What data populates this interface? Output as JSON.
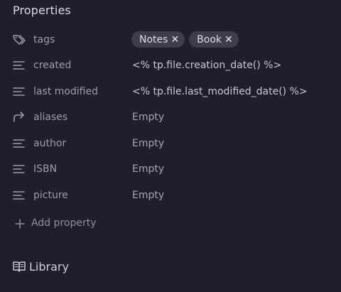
{
  "properties": {
    "heading": "Properties",
    "rows": [
      {
        "icon": "tags-icon",
        "key": "tags",
        "tags": [
          "Notes",
          "Book"
        ],
        "remove_glyph": "✕"
      },
      {
        "icon": "text-lines-icon",
        "key": "created",
        "value": "<% tp.file.creation_date() %>"
      },
      {
        "icon": "text-lines-icon",
        "key": "last modified",
        "value": "<% tp.file.last_modified_date() %>"
      },
      {
        "icon": "forward-arrow-icon",
        "key": "aliases",
        "value": "Empty"
      },
      {
        "icon": "text-lines-icon",
        "key": "author",
        "value": "Empty"
      },
      {
        "icon": "text-lines-icon",
        "key": "ISBN",
        "value": "Empty"
      },
      {
        "icon": "text-lines-icon",
        "key": "picture",
        "value": "Empty"
      }
    ],
    "add_label": "Add property"
  },
  "backlink": {
    "icon": "open-book-icon",
    "label": "Library"
  },
  "colors": {
    "background": "#1f1e2b",
    "pill": "#3e3d4b",
    "muted": "#9c9bb0"
  }
}
